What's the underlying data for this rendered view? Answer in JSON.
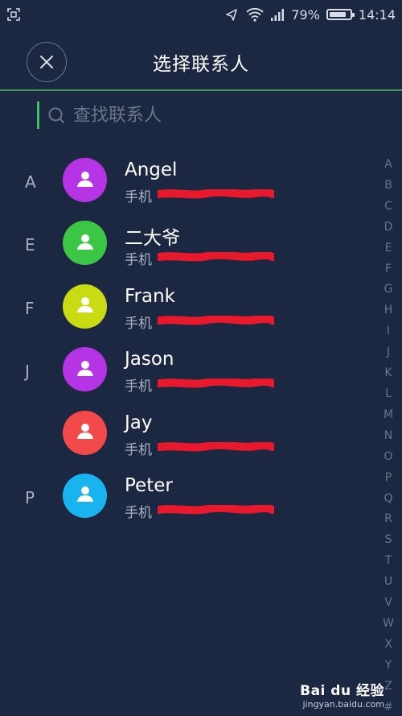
{
  "status_bar": {
    "battery": "79%",
    "time": "14:14"
  },
  "header": {
    "title": "选择联系人"
  },
  "search": {
    "placeholder": "查找联系人"
  },
  "contacts": [
    {
      "letter": "A",
      "name": "Angel",
      "phone_label": "手机",
      "avatar_color": "#b535e6"
    },
    {
      "letter": "E",
      "name": "二大爷",
      "phone_label": "手机",
      "avatar_color": "#3cc646"
    },
    {
      "letter": "F",
      "name": "Frank",
      "phone_label": "手机",
      "avatar_color": "#c9db13"
    },
    {
      "letter": "J",
      "name": "Jason",
      "phone_label": "手机",
      "avatar_color": "#b535e6"
    },
    {
      "letter": "",
      "name": "Jay",
      "phone_label": "手机",
      "avatar_color": "#f24a4a"
    },
    {
      "letter": "P",
      "name": "Peter",
      "phone_label": "手机",
      "avatar_color": "#19b4f0"
    }
  ],
  "alphabet_index": [
    "A",
    "B",
    "C",
    "D",
    "E",
    "F",
    "G",
    "H",
    "I",
    "J",
    "K",
    "L",
    "M",
    "N",
    "O",
    "P",
    "Q",
    "R",
    "S",
    "T",
    "U",
    "V",
    "W",
    "X",
    "Y",
    "Z",
    "#"
  ],
  "watermark": {
    "logo": "Bai du 经验",
    "url": "jingyan.baidu.com"
  },
  "colors": {
    "background": "#1c2741",
    "accent": "#3ec06a",
    "redaction": "#e8192c"
  }
}
